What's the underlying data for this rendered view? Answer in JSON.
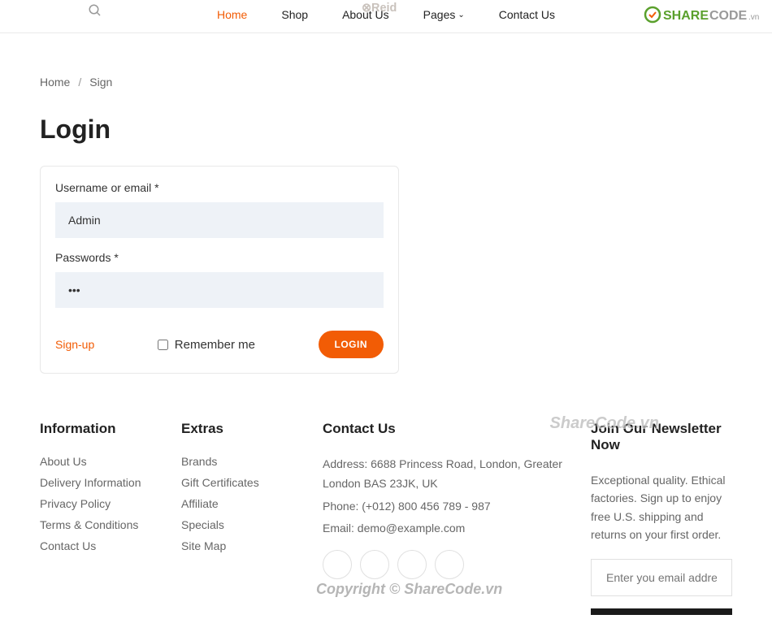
{
  "header": {
    "nav": [
      {
        "label": "Home",
        "active": true
      },
      {
        "label": "Shop",
        "active": false
      },
      {
        "label": "About Us",
        "active": false
      },
      {
        "label": "Pages",
        "active": false,
        "hasDropdown": true
      },
      {
        "label": "Contact Us",
        "active": false
      }
    ],
    "logo_text": "Reid"
  },
  "breadcrumb": {
    "home": "Home",
    "current": "Sign"
  },
  "login": {
    "title": "Login",
    "username_label": "Username or email *",
    "username_value": "Admin",
    "password_label": "Passwords *",
    "password_value": "•••",
    "signup_link": "Sign-up",
    "remember_label": "Remember me",
    "login_button": "LOGIN"
  },
  "footer": {
    "information": {
      "title": "Information",
      "items": [
        "About Us",
        "Delivery Information",
        "Privacy Policy",
        "Terms & Conditions",
        "Contact Us"
      ]
    },
    "extras": {
      "title": "Extras",
      "items": [
        "Brands",
        "Gift Certificates",
        "Affiliate",
        "Specials",
        "Site Map"
      ]
    },
    "contact": {
      "title": "Contact Us",
      "address": "Address: 6688 Princess Road, London, Greater London BAS 23JK, UK",
      "phone": "Phone: (+012) 800 456 789 - 987",
      "email": "Email: demo@example.com"
    },
    "newsletter": {
      "title": "Join Our Newsletter Now",
      "text": "Exceptional quality. Ethical factories. Sign up to enjoy free U.S. shipping and returns on your first order.",
      "placeholder": "Enter you email address here..."
    }
  },
  "watermarks": {
    "mid": "ShareCode.vn",
    "copyright": "Copyright © ShareCode.vn"
  }
}
